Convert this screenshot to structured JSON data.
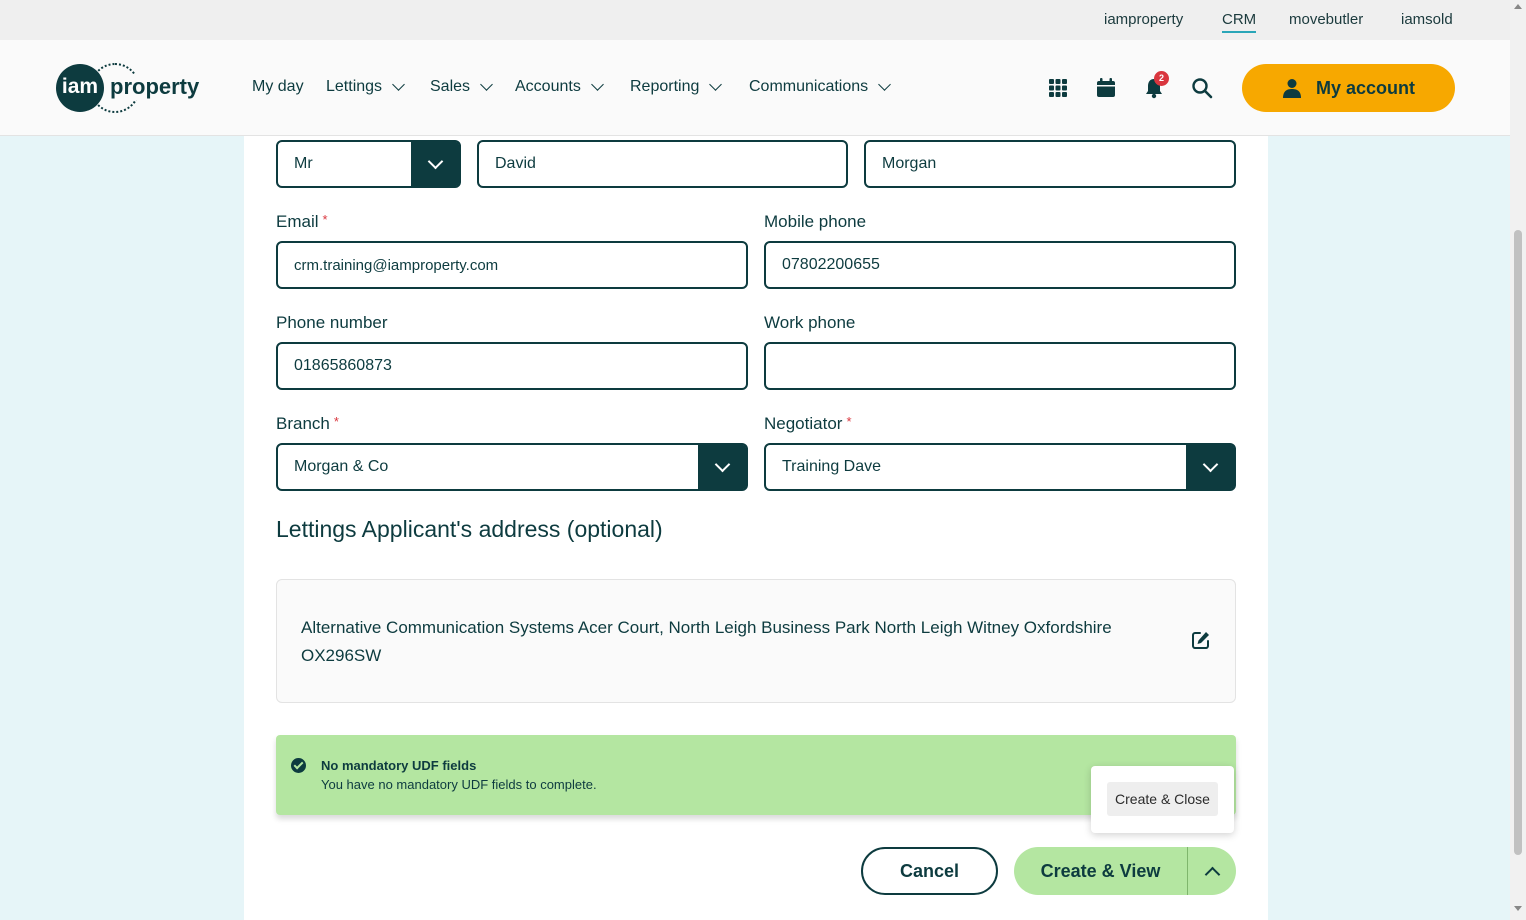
{
  "brand_links": [
    {
      "label": "iamproperty",
      "active": false
    },
    {
      "label": "CRM",
      "active": true
    },
    {
      "label": "movebutler",
      "active": false
    },
    {
      "label": "iamsold",
      "active": false
    }
  ],
  "logo": {
    "mark": "iam",
    "word": "property"
  },
  "nav": [
    {
      "label": "My day",
      "dropdown": false
    },
    {
      "label": "Lettings",
      "dropdown": true
    },
    {
      "label": "Sales",
      "dropdown": true
    },
    {
      "label": "Accounts",
      "dropdown": true
    },
    {
      "label": "Reporting",
      "dropdown": true
    },
    {
      "label": "Communications",
      "dropdown": true
    }
  ],
  "header_icons": [
    "apps-grid-icon",
    "calendar-icon",
    "bell-icon",
    "search-icon"
  ],
  "notifications": {
    "count": "2"
  },
  "account": {
    "label": "My account",
    "icon": "user-icon"
  },
  "form": {
    "title_value": "Mr",
    "first_name": "David",
    "last_name": "Morgan",
    "email_label": "Email",
    "email_value": "crm.training@iamproperty.com",
    "mobile_label": "Mobile phone",
    "mobile_value": "07802200655",
    "phone_label": "Phone number",
    "phone_value": "01865860873",
    "work_label": "Work phone",
    "work_value": "",
    "branch_label": "Branch",
    "branch_value": "Morgan & Co",
    "negotiator_label": "Negotiator",
    "negotiator_value": "Training Dave",
    "required_mark": "*"
  },
  "address": {
    "section_title": "Lettings Applicant's address (optional)",
    "text": "Alternative Communication Systems Acer Court, North Leigh Business Park North Leigh Witney Oxfordshire OX296SW"
  },
  "udf": {
    "title": "No mandatory UDF fields",
    "message": "You have no mandatory UDF fields to complete."
  },
  "actions": {
    "cancel": "Cancel",
    "create_view": "Create & View",
    "create_close": "Create & Close"
  },
  "colors": {
    "primary": "#0d3b3f",
    "accent": "#f7a800",
    "success": "#b4e6a1",
    "required": "#d9363e",
    "background": "#e6f5f8"
  }
}
